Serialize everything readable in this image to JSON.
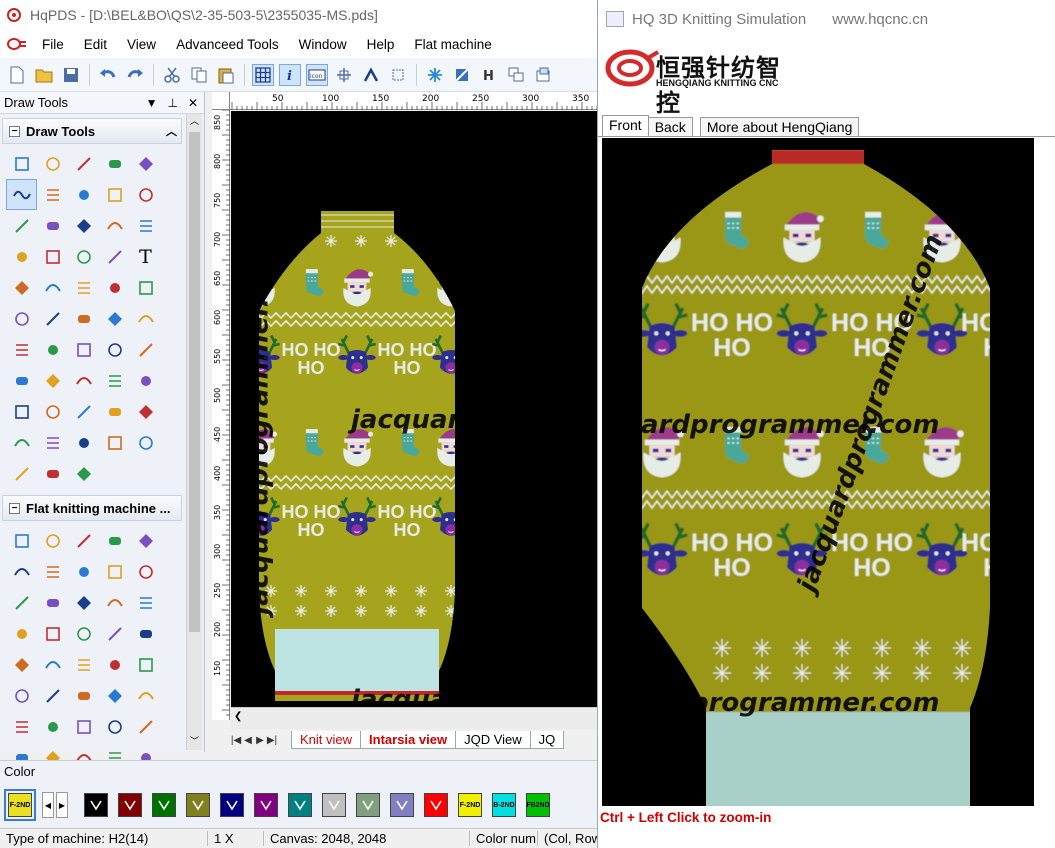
{
  "main_window": {
    "title": "HqPDS - [D:\\BEL&BO\\QS\\2-35-503-5\\2355035-MS.pds]"
  },
  "menu": {
    "items": [
      "File",
      "Edit",
      "View",
      "Advanceed Tools",
      "Window",
      "Help",
      "Flat machine"
    ]
  },
  "left_panel": {
    "header": "Draw Tools",
    "section_draw": "Draw Tools",
    "section_flat": "Flat knitting machine ..."
  },
  "ruler": {
    "h_ticks": [
      "50",
      "100",
      "150",
      "200",
      "250",
      "300",
      "350"
    ],
    "v_ticks": [
      "850",
      "800",
      "750",
      "700",
      "650",
      "600",
      "550",
      "500",
      "450",
      "400",
      "350",
      "300",
      "250",
      "200",
      "150"
    ]
  },
  "view_tabs": {
    "knit": "Knit view",
    "intarsia": "Intarsia view",
    "jqd": "JQD View",
    "more": "JQ"
  },
  "color_panel": {
    "label": "Color",
    "swatches": [
      {
        "code": "F-2ND",
        "color": "#e8e020"
      },
      {
        "code": "",
        "color": "#000000"
      },
      {
        "code": "",
        "color": "#800000"
      },
      {
        "code": "",
        "color": "#007000"
      },
      {
        "code": "",
        "color": "#808020"
      },
      {
        "code": "",
        "color": "#000080"
      },
      {
        "code": "",
        "color": "#800080"
      },
      {
        "code": "",
        "color": "#008080"
      },
      {
        "code": "",
        "color": "#c0c0c0"
      },
      {
        "code": "",
        "color": "#80a080"
      },
      {
        "code": "",
        "color": "#8080c0"
      },
      {
        "code": "",
        "color": "#ff0000"
      },
      {
        "code": "F-2ND",
        "color": "#f0f000"
      },
      {
        "code": "B-2ND",
        "color": "#00e0e0"
      },
      {
        "code": "FB2ND",
        "color": "#00c000"
      }
    ]
  },
  "status": {
    "machine": "Type of machine: H2(14)",
    "zoom": "1 X",
    "canvas": "Canvas: 2048, 2048",
    "color_num": "Color num",
    "col_row": "(Col, Row"
  },
  "sim_window": {
    "title": "HQ 3D Knitting Simulation",
    "url": "www.hqcnc.cn",
    "logo_cn": "恒强针纺智控",
    "logo_en": "HENGQIANG KNITTING CNC",
    "tabs": [
      "Front",
      "Back",
      "More about HengQiang"
    ],
    "hint": "Ctrl + Left Click to zoom-in"
  },
  "design": {
    "text": "HO HO HO",
    "colors": {
      "body": "#a6a41c",
      "rib": "#bde3e3",
      "snow": "#e6ece6",
      "hat": "#9c3a8a",
      "sock": "#4aa89a",
      "reindeer": "#2d2f8e",
      "antler": "#1e6b2c",
      "nose": "#8d2f9f",
      "top_band": "#c0282a"
    }
  },
  "watermarks": [
    "jacquardprogrammer.com",
    "jacquardprogrammer.com",
    "jacquardprogrammer.com"
  ]
}
